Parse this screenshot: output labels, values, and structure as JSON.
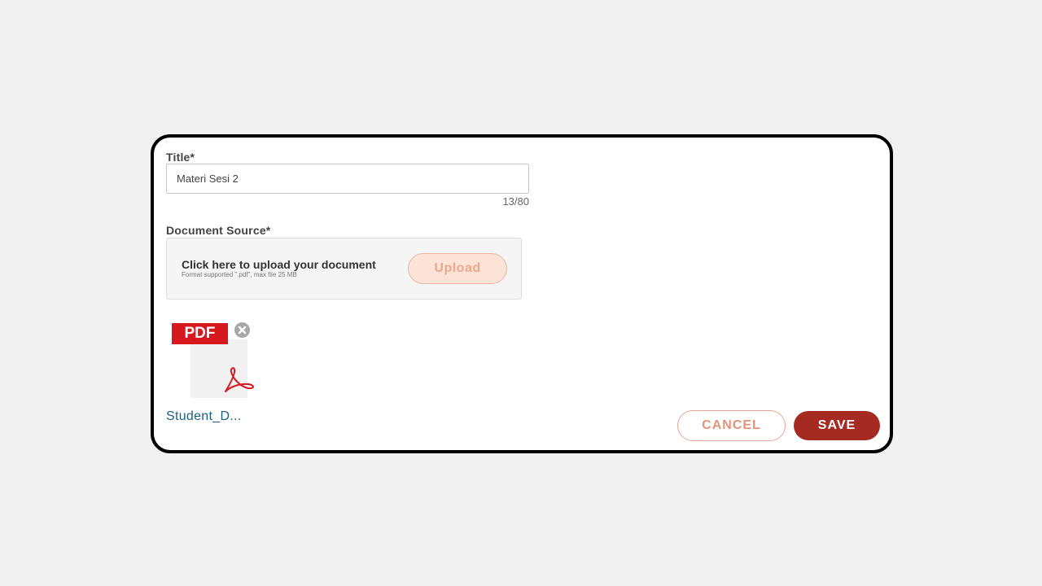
{
  "form": {
    "title_label": "Title*",
    "title_value": "Materi Sesi 2",
    "char_count": "13/80",
    "source_label": "Document Source*",
    "upload_prompt": "Click here to upload your document",
    "upload_hint": "Format supported \".pdf\", max file 25 MB",
    "upload_button": "Upload"
  },
  "attachment": {
    "badge": "PDF",
    "icon": "pdf-file-icon",
    "file_name": "Student_D..."
  },
  "actions": {
    "cancel_label": "CANCEL",
    "save_label": "SAVE"
  },
  "colors": {
    "primary": "#a52a22",
    "upload_bg": "#fbe3d8",
    "link": "#1a5f84",
    "pdf_red": "#d7191f"
  }
}
